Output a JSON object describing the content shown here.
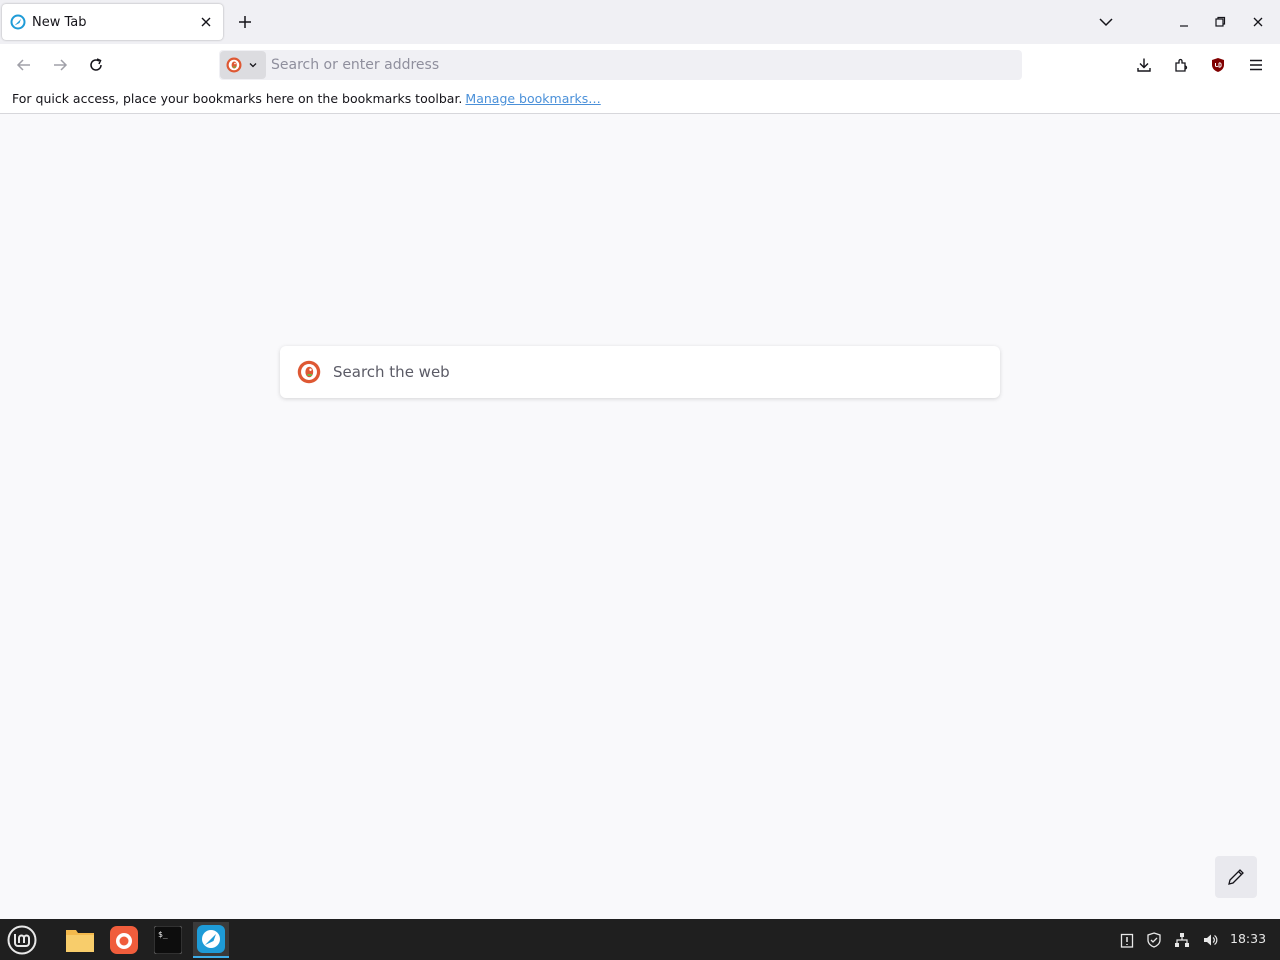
{
  "tabs": [
    {
      "title": "New Tab",
      "active": true
    }
  ],
  "navbar": {
    "url_placeholder": "Search or enter address"
  },
  "bookmarks_bar": {
    "message": "For quick access, place your bookmarks here on the bookmarks toolbar.",
    "manage_link": "Manage bookmarks…"
  },
  "newtab": {
    "search_placeholder": "Search the web"
  },
  "taskbar": {
    "clock": "18:33"
  },
  "colors": {
    "accent": "#3daee9",
    "link": "#4a90d9",
    "duckduckgo": "#de5833"
  }
}
